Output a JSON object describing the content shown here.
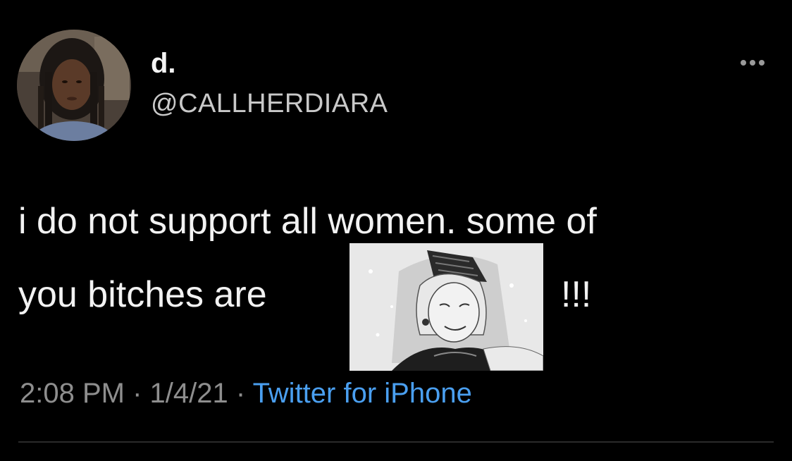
{
  "user": {
    "display_name": "d.",
    "handle": "@CALLHERDIARA"
  },
  "icons": {
    "more": "more-horizontal-icon"
  },
  "tweet": {
    "line1": "i do not support all women. some of",
    "line2_prefix": "you bitches are",
    "line2_suffix": "!!!",
    "image": "manga-old-woman-image"
  },
  "meta": {
    "time": "2:08 PM",
    "separator1": " · ",
    "date": "1/4/21",
    "separator2": " · ",
    "source": "Twitter for iPhone"
  },
  "colors": {
    "background": "#000000",
    "text": "#f2f2f2",
    "secondary_text": "#8e8e8e",
    "link": "#4a9ff0"
  }
}
